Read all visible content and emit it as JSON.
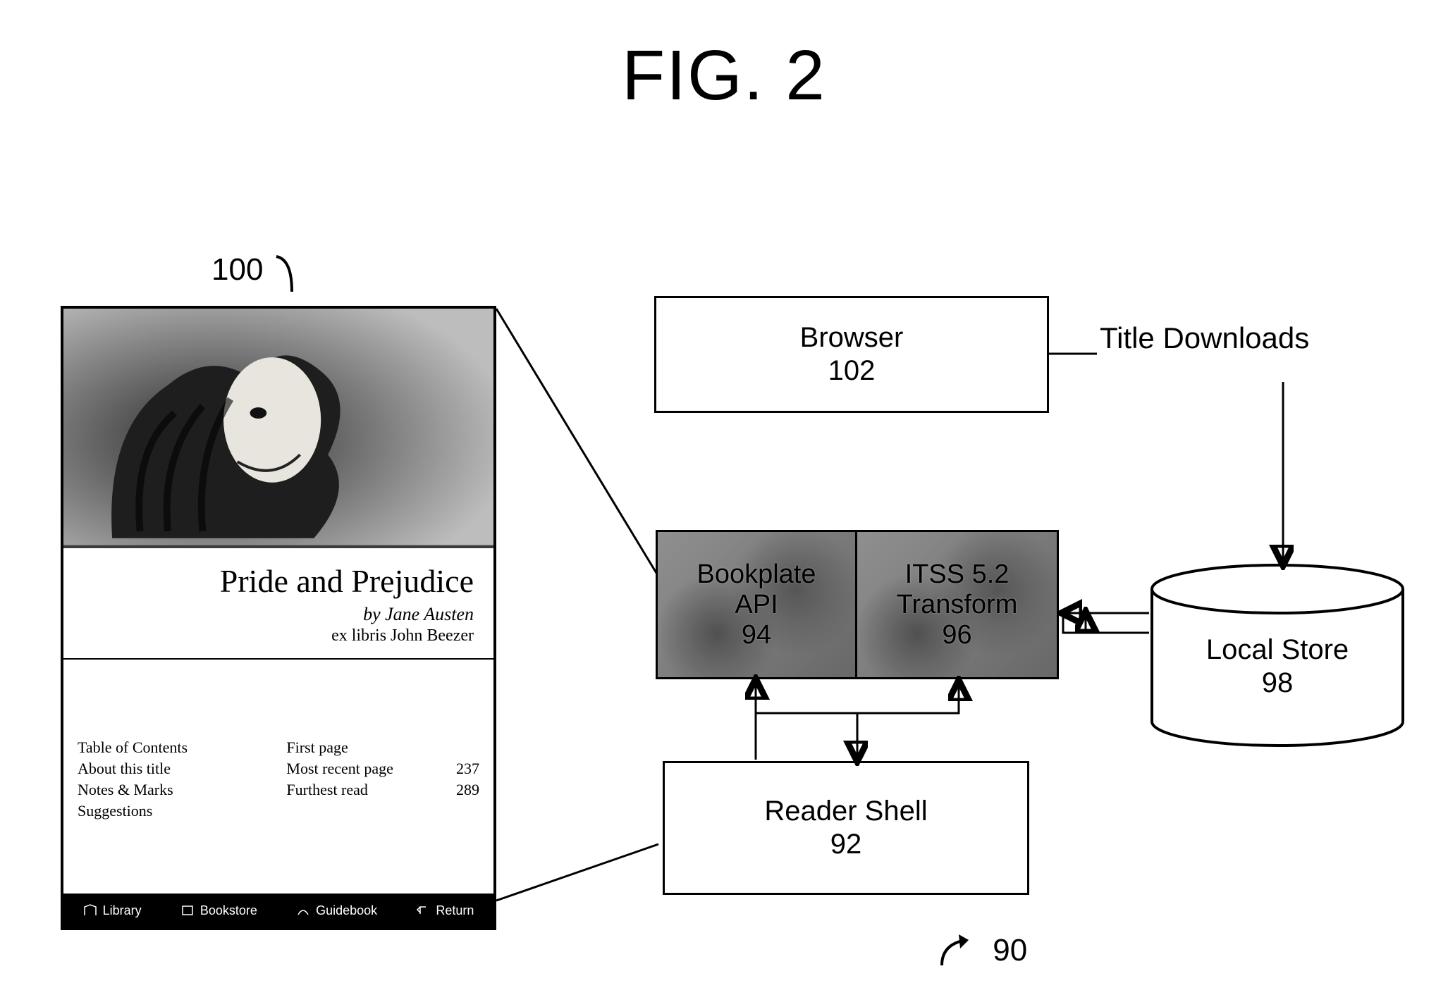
{
  "figure": {
    "title": "FIG. 2",
    "system_ref": "90"
  },
  "bookplate": {
    "ref": "100",
    "title": "Pride and Prejudice",
    "author": "by Jane Austen",
    "exlibris": "ex libris John Beezer",
    "links_col1": [
      "Table of Contents",
      "About this title",
      "Notes & Marks",
      "Suggestions"
    ],
    "links_col2": [
      {
        "label": "First page",
        "page": ""
      },
      {
        "label": "Most recent page",
        "page": "237"
      },
      {
        "label": "Furthest read",
        "page": "289"
      }
    ],
    "nav": [
      "Library",
      "Bookstore",
      "Guidebook",
      "Return"
    ]
  },
  "browser": {
    "label": "Browser",
    "ref": "102"
  },
  "modules": {
    "api": {
      "line1": "Bookplate",
      "line2": "API",
      "ref": "94"
    },
    "xform": {
      "line1": "ITSS 5.2",
      "line2": "Transform",
      "ref": "96"
    }
  },
  "reader": {
    "label": "Reader Shell",
    "ref": "92"
  },
  "store": {
    "label": "Local Store",
    "ref": "98"
  },
  "download_label": "Title Downloads"
}
